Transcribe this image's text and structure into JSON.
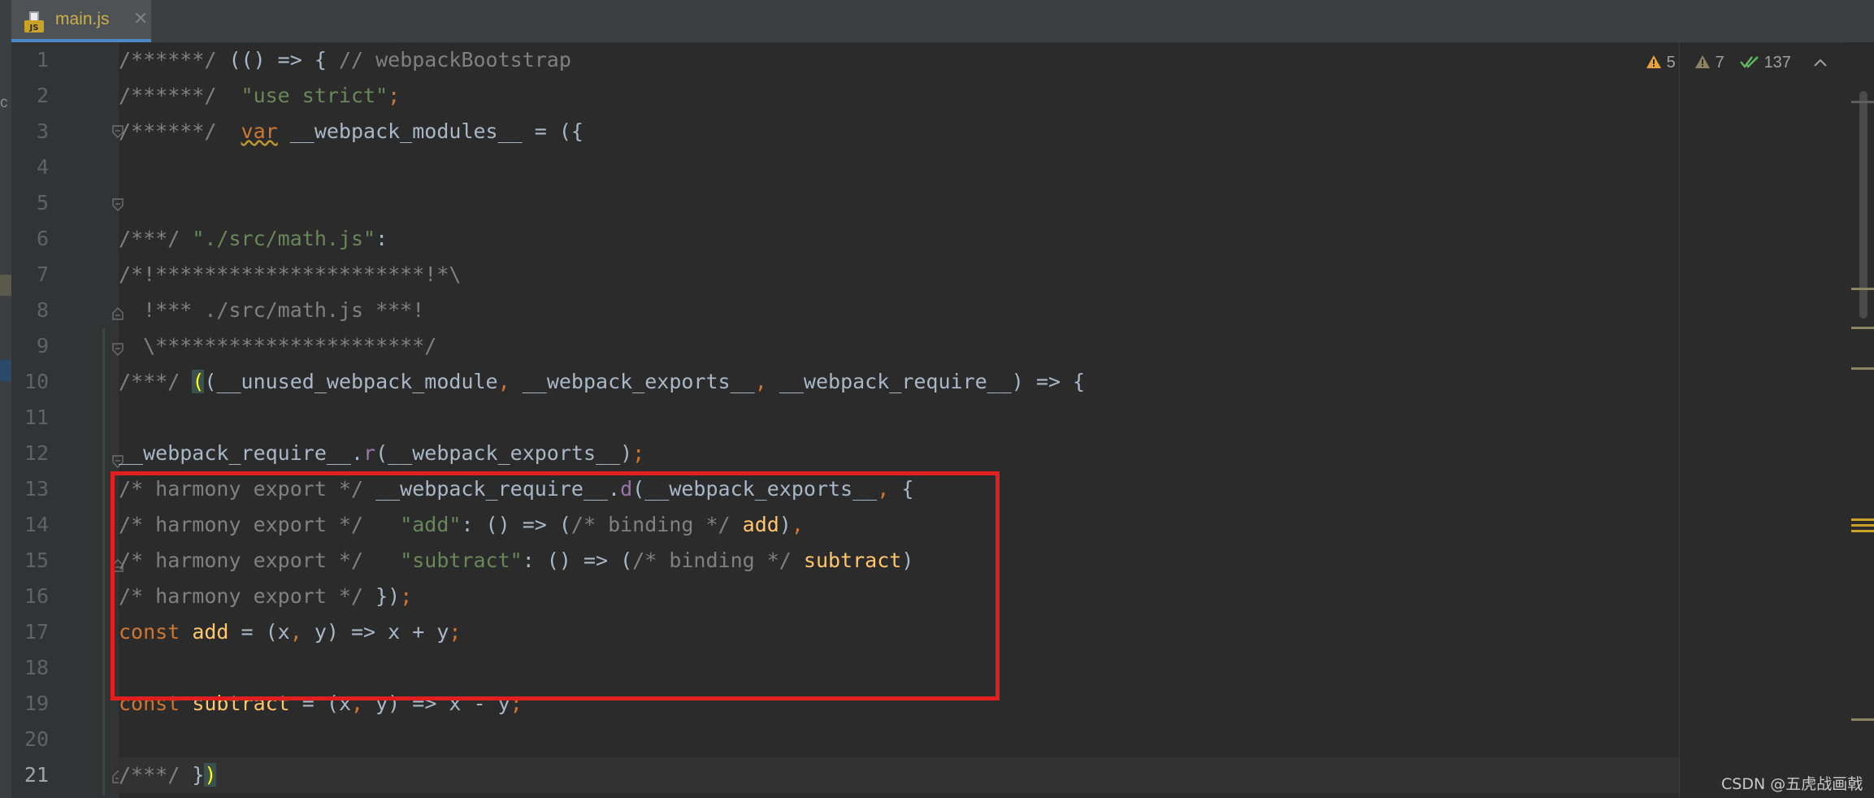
{
  "tab": {
    "filename": "main.js",
    "file_type": "JS",
    "icon": "js-file-icon",
    "close_icon": "close-icon",
    "label_color": "#c9b04a"
  },
  "sidebar_letter": "c",
  "inspection": {
    "errors": "5",
    "warnings": "7",
    "checks": "137",
    "error_icon": "warning-triangle-icon",
    "warning_icon": "weak-warning-triangle-icon",
    "check_icon": "double-check-icon"
  },
  "current_line": "21",
  "lines": [
    {
      "num": "1"
    },
    {
      "num": "2"
    },
    {
      "num": "3"
    },
    {
      "num": "4"
    },
    {
      "num": "5"
    },
    {
      "num": "6"
    },
    {
      "num": "7"
    },
    {
      "num": "8"
    },
    {
      "num": "9"
    },
    {
      "num": "10"
    },
    {
      "num": "11"
    },
    {
      "num": "12"
    },
    {
      "num": "13"
    },
    {
      "num": "14"
    },
    {
      "num": "15"
    },
    {
      "num": "16"
    },
    {
      "num": "17"
    },
    {
      "num": "18"
    },
    {
      "num": "19"
    },
    {
      "num": "20"
    },
    {
      "num": "21"
    }
  ],
  "code": {
    "l1_cm": "/******/ ",
    "l1_code": "(() => { ",
    "l1_cm2": "// webpackBootstrap",
    "l2_cm": "/******/  ",
    "l2_str": "\"use strict\"",
    "l2_semi": ";",
    "l3_cm": "/******/  ",
    "l3_kw": "var",
    "l3_code": " __webpack_modules__ = ({",
    "l5_cm": "/***/ ",
    "l5_str": "\"./src/math.js\"",
    "l5_code": ":",
    "l6_cm": "/*!**********************!*\\",
    "l7_cm": "  !*** ./src/math.js ***!",
    "l8_cm": "  \\**********************/",
    "l9_cm": "/***/ ",
    "l9_paren": "(",
    "l9_a": "(__unused_webpack_module",
    "l9_c1": ", ",
    "l9_b": "__webpack_exports__",
    "l9_c2": ", ",
    "l9_c": "__webpack_require__) => {",
    "l11_a": "__webpack_require__.",
    "l11_m": "r",
    "l11_b": "(__webpack_exports__)",
    "l11_s": ";",
    "l12_cm": "/* harmony export */ ",
    "l12_a": "__webpack_require__.",
    "l12_m": "d",
    "l12_b": "(__webpack_exports__",
    "l12_c": ", ",
    "l12_d": "{",
    "l13_cm": "/* harmony export */   ",
    "l13_str": "\"add\"",
    "l13_a": ": () => (",
    "l13_cm2": "/* binding */ ",
    "l13_fn": "add",
    "l13_b": ")",
    "l13_c": ",",
    "l14_cm": "/* harmony export */   ",
    "l14_str": "\"subtract\"",
    "l14_a": ": () => (",
    "l14_cm2": "/* binding */ ",
    "l14_fn": "subtract",
    "l14_b": ")",
    "l15_cm": "/* harmony export */ ",
    "l15_a": "})",
    "l15_s": ";",
    "l16_kw": "const ",
    "l16_fn": "add",
    "l16_a": " = (x",
    "l16_c": ", ",
    "l16_b": "y) => x + y",
    "l16_s": ";",
    "l18_kw": "const ",
    "l18_fn": "subtract",
    "l18_a": " = (x",
    "l18_c": ", ",
    "l18_b": "y) => x - y",
    "l18_s": ";",
    "l21_cm": "/***/ ",
    "l21_a": "}",
    "l21_b": ")"
  },
  "watermark": "CSDN @五虎战画戟",
  "colors": {
    "background": "#2b2b2b",
    "comment": "#808080",
    "string": "#6a8759",
    "keyword": "#cc7832",
    "function": "#ffc66d",
    "highlight_box": "#e11f1f"
  }
}
